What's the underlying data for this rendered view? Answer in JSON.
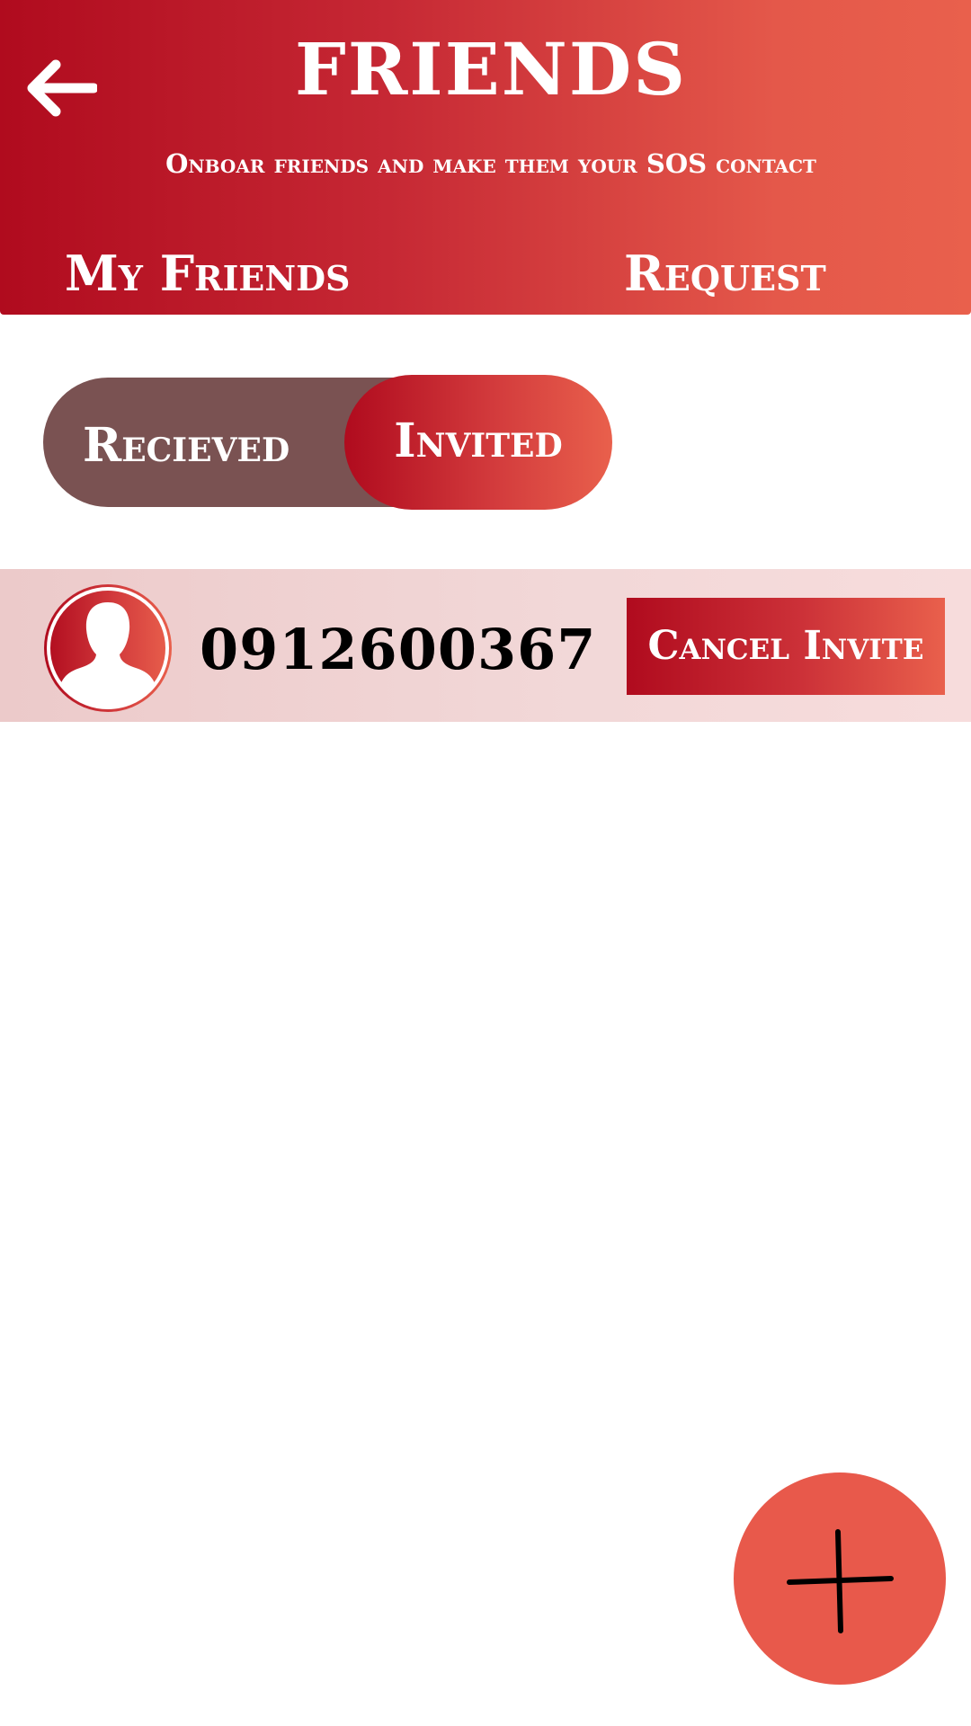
{
  "header": {
    "title": "FRIENDS",
    "subtitle": "Onboar friends and make them your SOS contact",
    "back_icon": "arrow-left-icon"
  },
  "tabs": [
    {
      "label": "My Friends"
    },
    {
      "label": "Request"
    }
  ],
  "toggle": {
    "options": [
      "Recieved",
      "Invited"
    ],
    "selected": "Invited"
  },
  "requests": [
    {
      "avatar_icon": "person-silhouette-icon",
      "phone": "0912600367",
      "action_label": "Cancel Invite"
    }
  ],
  "fab": {
    "icon": "plus-icon"
  },
  "colors": {
    "gradient_start": "#b00b1e",
    "gradient_end": "#e9604c",
    "toggle_inactive": "#7a5252",
    "row_background": "#f2d8d8",
    "fab": "#e8594b"
  }
}
